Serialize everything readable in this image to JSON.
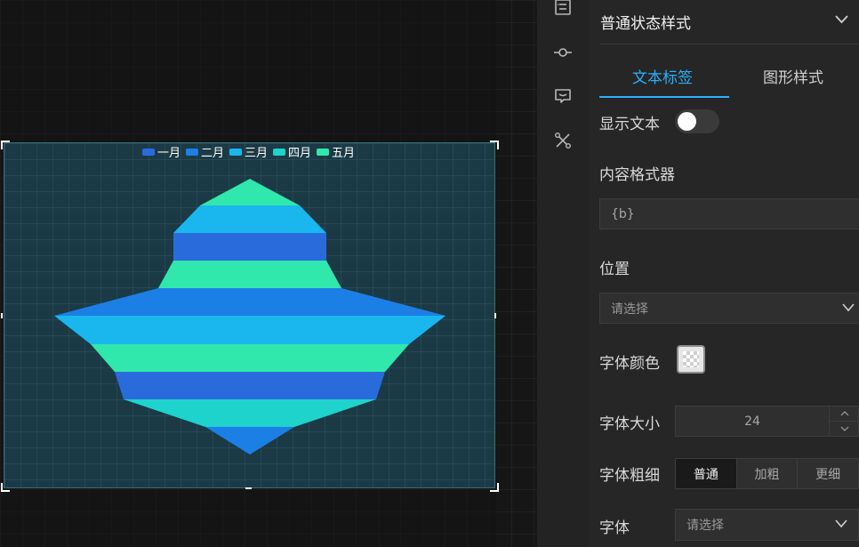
{
  "canvas": {
    "chart_data": {
      "type": "funnel",
      "legend": [
        "一月",
        "二月",
        "三月",
        "四月",
        "五月"
      ],
      "legend_position": "top-center",
      "colors": {
        "一月": "#2a6bdc",
        "二月": "#1c7fe6",
        "三月": "#1ab6ee",
        "四月": "#1ed3cc",
        "五月": "#31e8ac"
      },
      "background": "#1b3a46"
    }
  },
  "panel": {
    "section_title": "普通状态样式",
    "tabs": [
      {
        "label": "文本标签",
        "active": true
      },
      {
        "label": "图形样式",
        "active": false
      }
    ],
    "show_text": {
      "label": "显示文本",
      "value": false
    },
    "formatter": {
      "label": "内容格式器",
      "value": "{b}"
    },
    "position": {
      "label": "位置",
      "placeholder": "请选择"
    },
    "font_color": {
      "label": "字体颜色"
    },
    "font_size": {
      "label": "字体大小",
      "value": "24"
    },
    "font_weight": {
      "label": "字体粗细",
      "options": [
        "普通",
        "加粗",
        "更细"
      ],
      "selected": "普通"
    },
    "font_family": {
      "label": "字体",
      "placeholder": "请选择"
    }
  },
  "rail": {
    "icons": [
      "list-icon",
      "node-link-icon",
      "message-icon",
      "tools-icon"
    ]
  }
}
